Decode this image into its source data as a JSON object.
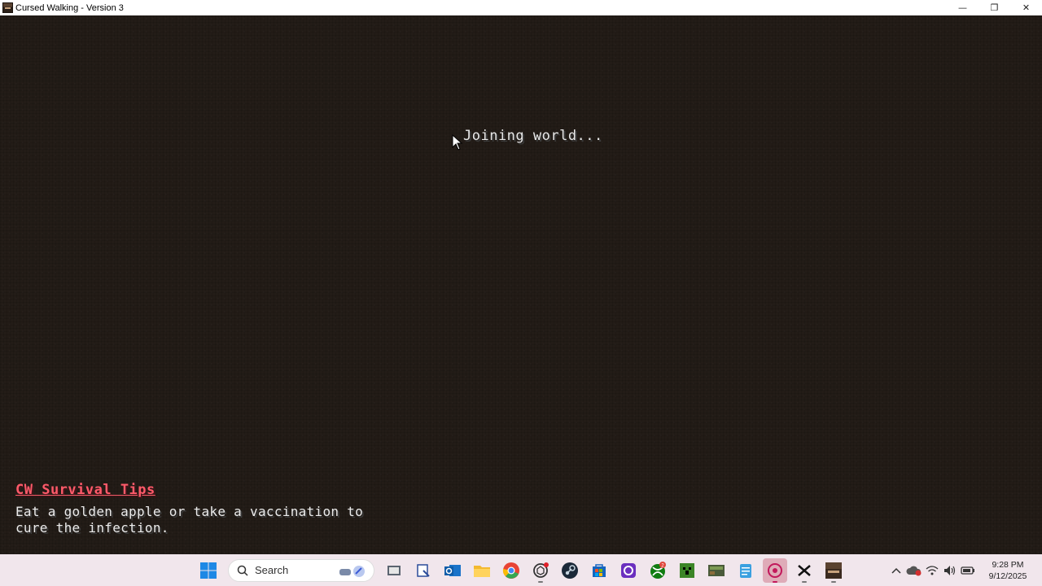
{
  "window": {
    "title": "Cursed Walking - Version 3",
    "controls": {
      "minimize": "—",
      "restore": "❐",
      "close": "✕"
    }
  },
  "game": {
    "status": "Joining world...",
    "tips": {
      "title": "CW Survival Tips",
      "body": "Eat a golden apple or take a vaccination to cure the infection."
    }
  },
  "taskbar": {
    "search_label": "Search",
    "apps": [
      "task-view",
      "snipping-tool",
      "outlook",
      "file-explorer",
      "chrome",
      "chatgpt",
      "steam",
      "microsoft-store",
      "app-purple",
      "xbox",
      "minecraft",
      "minecraft-legacy",
      "notepad",
      "app-pink-active",
      "capcut",
      "game-cursed-walking"
    ],
    "badges": {
      "xbox": "2"
    },
    "clock": {
      "time": "9:28 PM",
      "date": "9/12/2025"
    }
  },
  "colors": {
    "tip_title": "#ff5a6a",
    "background": "#231c17",
    "taskbar": "#f1e6ec"
  }
}
